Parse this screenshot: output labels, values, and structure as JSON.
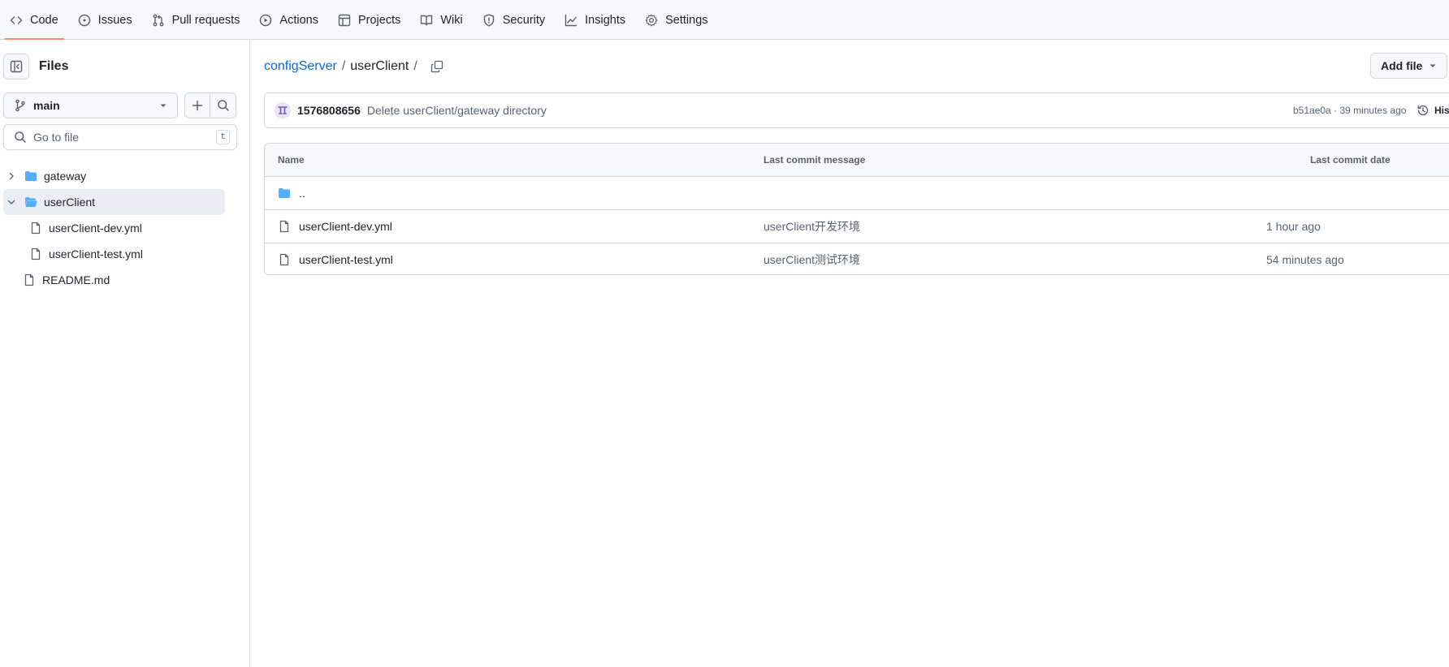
{
  "nav": {
    "tabs": [
      {
        "label": "Code",
        "icon": "code-icon"
      },
      {
        "label": "Issues",
        "icon": "issue-opened-icon"
      },
      {
        "label": "Pull requests",
        "icon": "git-pull-request-icon"
      },
      {
        "label": "Actions",
        "icon": "play-icon"
      },
      {
        "label": "Projects",
        "icon": "table-icon"
      },
      {
        "label": "Wiki",
        "icon": "book-icon"
      },
      {
        "label": "Security",
        "icon": "shield-icon"
      },
      {
        "label": "Insights",
        "icon": "graph-icon"
      },
      {
        "label": "Settings",
        "icon": "gear-icon"
      }
    ],
    "active": "Code",
    "active_color": "#fd8c73"
  },
  "sidebar": {
    "title": "Files",
    "branch": "main",
    "goto_placeholder": "Go to file",
    "goto_shortcut": "t",
    "tree": [
      {
        "label": "gateway",
        "type": "folder",
        "expanded": false
      },
      {
        "label": "userClient",
        "type": "folder",
        "expanded": true,
        "selected": true
      },
      {
        "label": "userClient-dev.yml",
        "type": "file"
      },
      {
        "label": "userClient-test.yml",
        "type": "file"
      },
      {
        "label": "README.md",
        "type": "file"
      }
    ]
  },
  "breadcrumb": {
    "repo": "configServer",
    "current": "userClient",
    "sep": "/"
  },
  "toolbar": {
    "add_file": "Add file"
  },
  "commit": {
    "author": "1576808656",
    "message": "Delete userClient/gateway directory",
    "meta": "b51ae0a · 39 minutes ago",
    "history_label": "History"
  },
  "table": {
    "headers": {
      "name": "Name",
      "message": "Last commit message",
      "date": "Last commit date"
    },
    "parent": "..",
    "rows": [
      {
        "name": "userClient-dev.yml",
        "message": "userClient开发环境",
        "date": "1 hour ago"
      },
      {
        "name": "userClient-test.yml",
        "message": "userClient测试环境",
        "date": "54 minutes ago"
      }
    ]
  },
  "colors": {
    "link": "#0969da",
    "folder": "#54aeff",
    "border": "#d1d9e0"
  }
}
